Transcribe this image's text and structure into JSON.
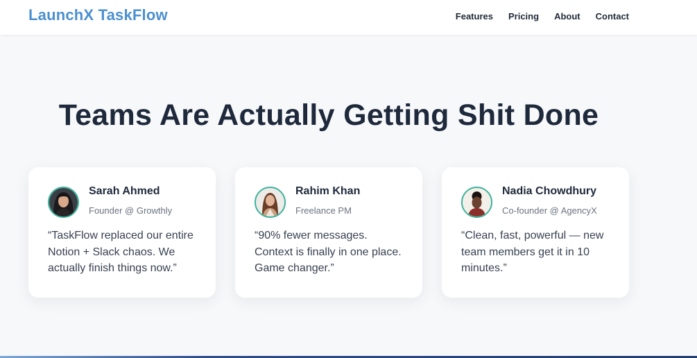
{
  "nav": {
    "brand": "LaunchX TaskFlow",
    "links": [
      {
        "label": "Features"
      },
      {
        "label": "Pricing"
      },
      {
        "label": "About"
      },
      {
        "label": "Contact"
      }
    ]
  },
  "headline": "Teams Are Actually Getting Shit Done",
  "testimonials": [
    {
      "name": "Sarah Ahmed",
      "role": "Founder @ Growthly",
      "quote": "“TaskFlow replaced our entire Notion + Slack chaos. We actually finish things now.”"
    },
    {
      "name": "Rahim Khan",
      "role": "Freelance PM",
      "quote": "“90% fewer messages. Context is finally in one place. Game changer.”"
    },
    {
      "name": "Nadia Chowdhury",
      "role": "Co-founder @ AgencyX",
      "quote": "“Clean, fast, powerful — new team members get it in 10 minutes.”"
    }
  ],
  "colors": {
    "brand": "#4a8fd1",
    "heading": "#1e293b",
    "avatar_ring": "#3bb39a"
  }
}
